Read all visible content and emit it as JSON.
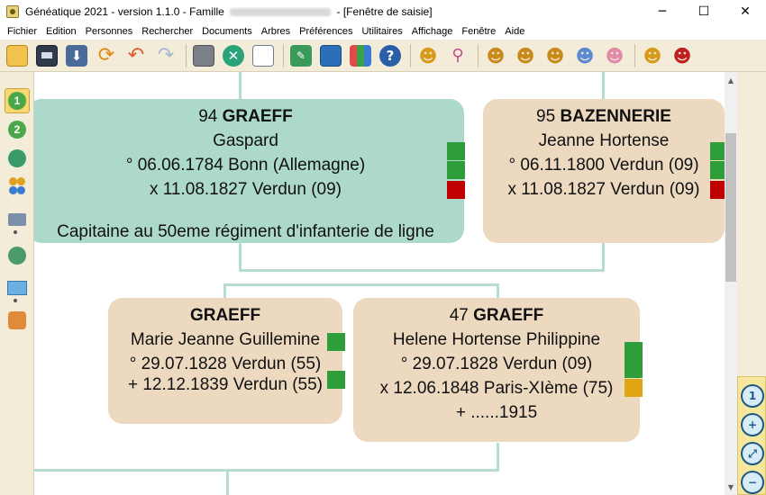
{
  "window": {
    "title_prefix": "Généatique 2021 - version 1.1.0 - Famille",
    "title_suffix": "- [Fenêtre de saisie]",
    "minimize": "─",
    "maximize": "☐",
    "close": "✕"
  },
  "menu": [
    "Fichier",
    "Edition",
    "Personnes",
    "Rechercher",
    "Documents",
    "Arbres",
    "Préférences",
    "Utilitaires",
    "Affichage",
    "Fenêtre",
    "Aide"
  ],
  "toolbar": {
    "icons": [
      "open-folder-icon",
      "save-icon",
      "import-icon",
      "refresh-icon",
      "undo-icon",
      "redo-icon",
      "print-icon",
      "tools-icon",
      "document-icon",
      "edit-icon",
      "window-icon",
      "palette-icon",
      "help-icon",
      "person-search-icon",
      "tree-branch-icon",
      "add-father-icon",
      "add-mother-icon",
      "add-sibling-icon",
      "add-child-icon",
      "add-spouse-icon",
      "add-person-icon",
      "delete-person-icon"
    ]
  },
  "sidebar": {
    "icons": [
      "generation-1-icon",
      "generation-2-icon",
      "tree-edit-icon",
      "family-tree-icon",
      "printer-icon",
      "tree-tools-icon",
      "map-pin-icon",
      "location-icon"
    ]
  },
  "cards": {
    "father": {
      "number": "94",
      "surname": "GRAEFF",
      "given": "Gaspard",
      "birth": "° 06.06.1784 Bonn (Allemagne)",
      "marriage": "x 11.08.1827 Verdun (09)",
      "note": "Capitaine au 50eme régiment d'infanterie de ligne"
    },
    "mother": {
      "number": "95",
      "surname": "BAZENNERIE",
      "given": "Jeanne Hortense",
      "birth": "° 06.11.1800 Verdun (09)",
      "marriage": "x 11.08.1827 Verdun (09)"
    },
    "child1": {
      "number": "",
      "surname": "GRAEFF",
      "given": "Marie Jeanne Guillemine",
      "birth": "° 29.07.1828 Verdun (55)",
      "death": "+ 12.12.1839 Verdun (55)"
    },
    "child2": {
      "number": "47",
      "surname": "GRAEFF",
      "given": "Helene Hortense Philippine",
      "birth": "° 29.07.1828 Verdun (09)",
      "marriage": "x 12.06.1848 Paris-XIème (75)",
      "death": "+ ......1915"
    }
  },
  "colors": {
    "card_teal": "#acd9cc",
    "card_tan": "#ecd9c0",
    "marker_green": "#2e9e3a",
    "marker_red": "#c00000",
    "marker_orange": "#e0a512",
    "panel_bg": "#f3ecd9"
  },
  "zoom": {
    "buttons": [
      "zoom-1-1-icon",
      "zoom-in-icon",
      "zoom-fit-icon",
      "zoom-out-icon"
    ],
    "labels": [
      "1",
      "+",
      "⤢",
      "−"
    ]
  }
}
